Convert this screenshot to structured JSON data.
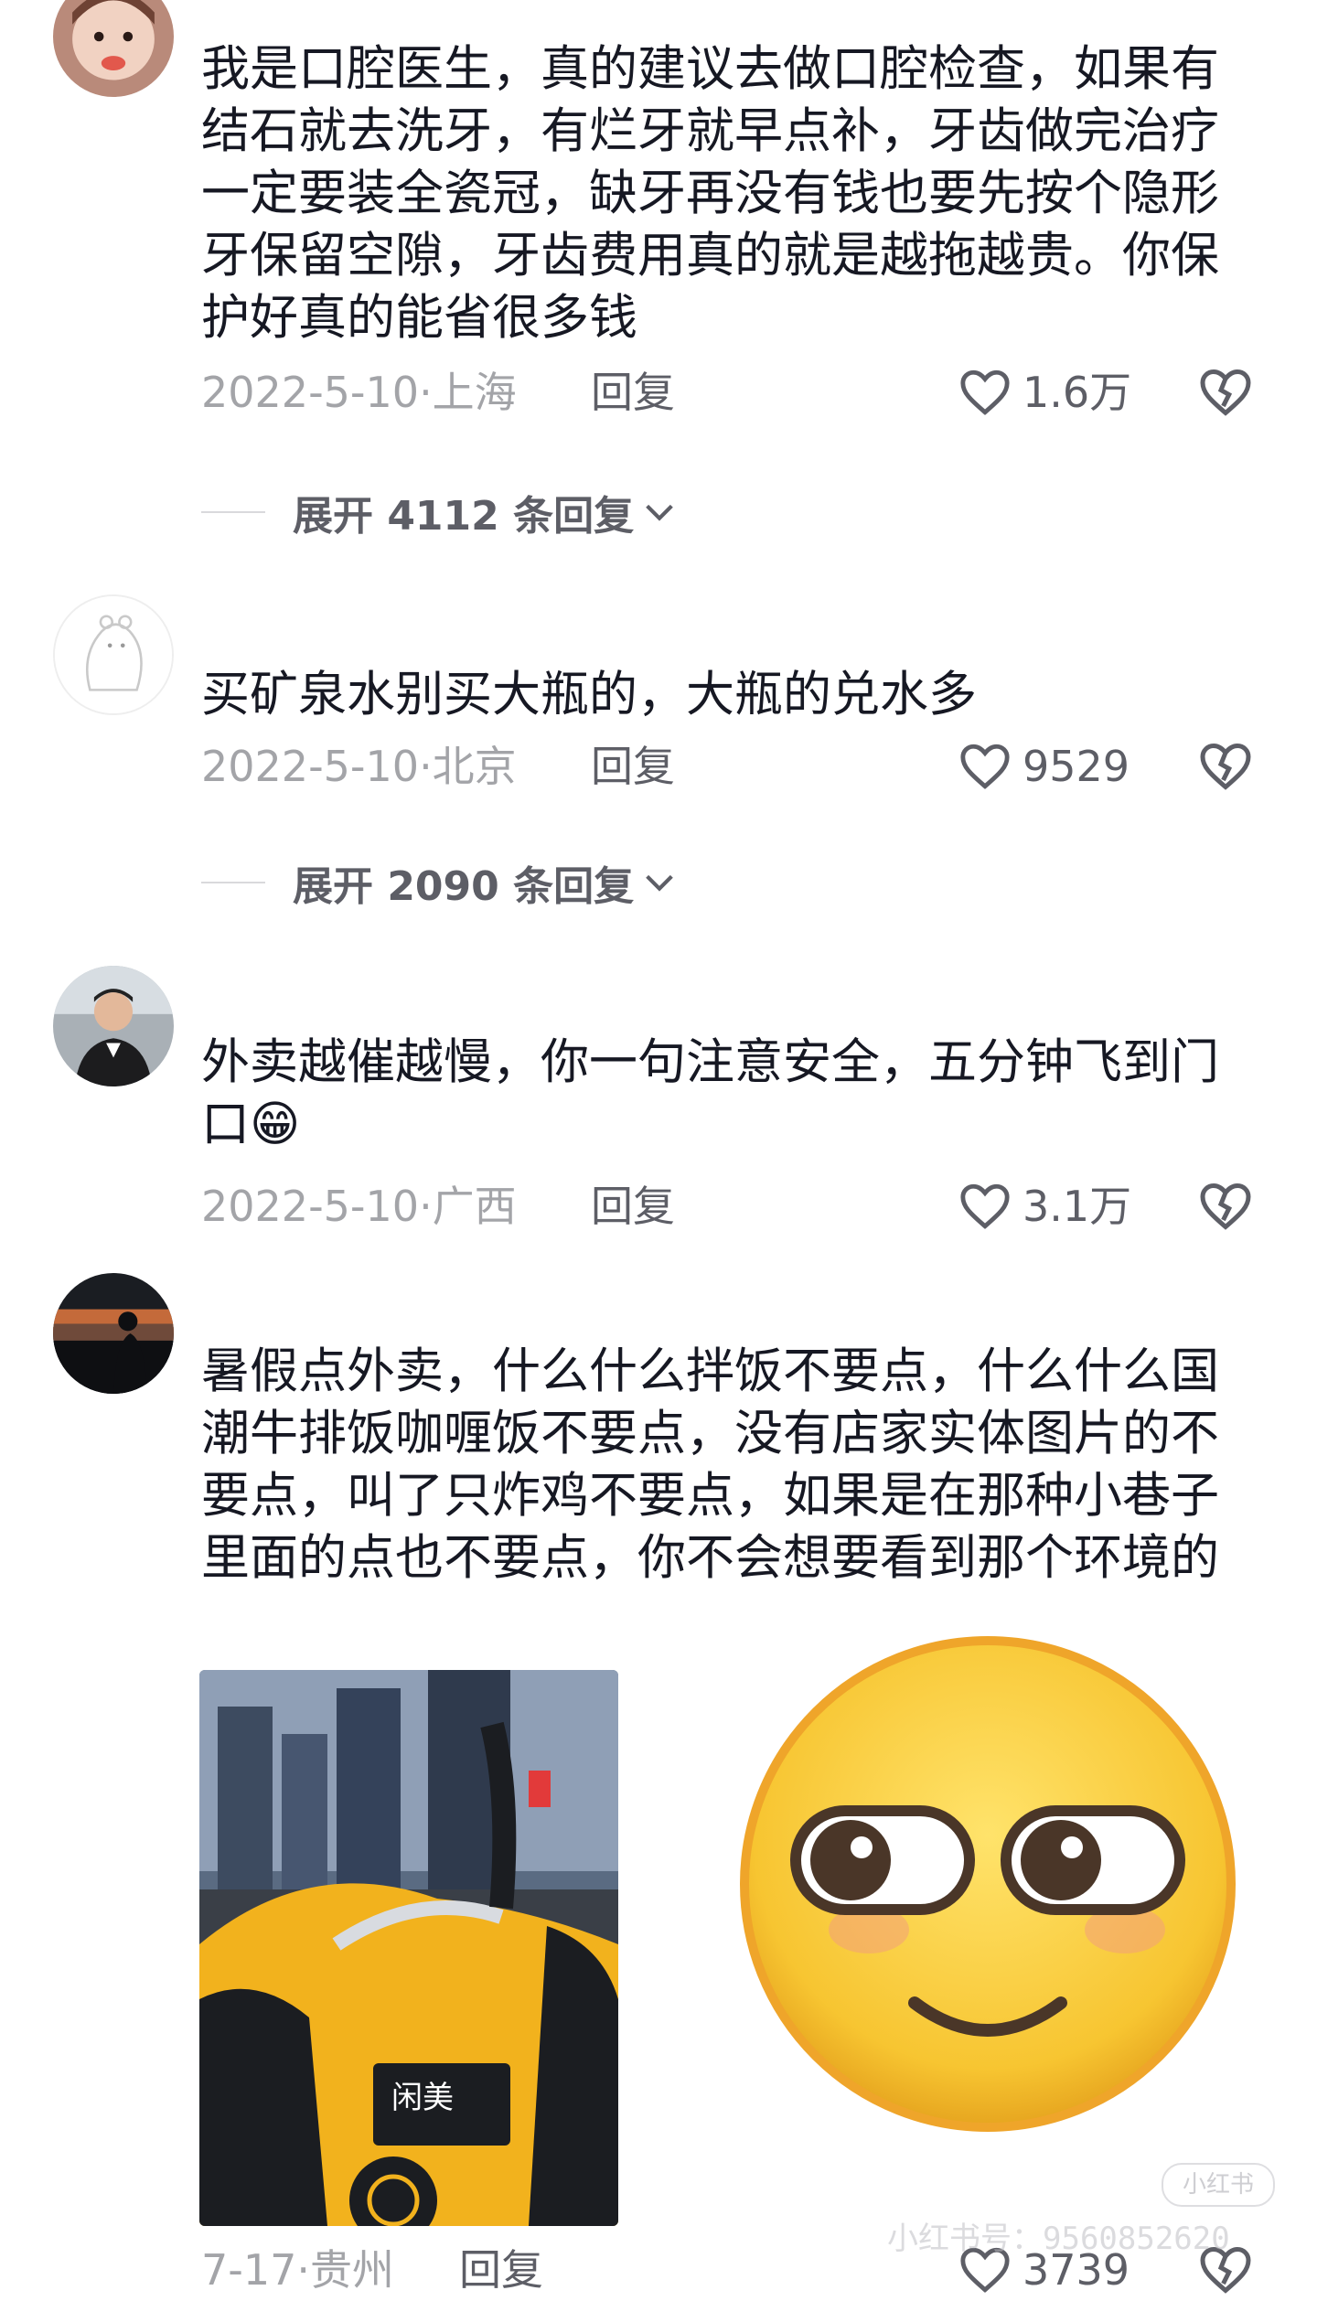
{
  "comments": [
    {
      "text": "我是口腔医生，真的建议去做口腔检查，如果有结石就去洗牙，有烂牙就早点补，牙齿做完治疗一定要装全瓷冠，缺牙再没有钱也要先按个隐形牙保留空隙，牙齿费用真的就是越拖越贵。你保护好真的能省很多钱",
      "date": "2022-5-10·上海",
      "reply_label": "回复",
      "likes": "1.6万",
      "expand_label": "展开 4112 条回复"
    },
    {
      "text": "买矿泉水别买大瓶的，大瓶的兑水多",
      "date": "2022-5-10·北京",
      "reply_label": "回复",
      "likes": "9529",
      "expand_label": "展开 2090 条回复"
    },
    {
      "text": "外卖越催越慢，你一句注意安全，五分钟飞到门口😁",
      "date": "2022-5-10·广西",
      "reply_label": "回复",
      "likes": "3.1万"
    },
    {
      "text": "暑假点外卖，什么什么拌饭不要点，什么什么国潮牛排饭咖喱饭不要点，没有店家实体图片的不要点，叫了只炸鸡不要点，如果是在那种小巷子里面的点也不要点，你不会想要看到那个环境的",
      "date": "7-17·贵州",
      "reply_label": "回复",
      "likes": "3739"
    }
  ],
  "photo_logo_text": "闲美",
  "watermark": {
    "badge": "小红书",
    "id_text": "小红书号：9560852620"
  },
  "icons": {
    "like": "heart-outline-icon",
    "dislike": "broken-heart-icon",
    "expand": "chevron-down-icon"
  }
}
